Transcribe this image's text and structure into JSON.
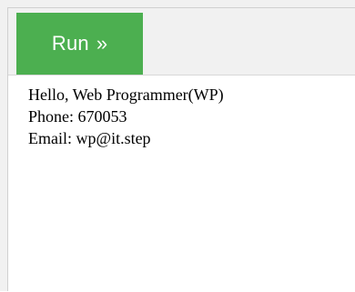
{
  "toolbar": {
    "run_label": "Run",
    "run_arrow": "»",
    "accent_color": "#4caf50"
  },
  "output": {
    "lines": [
      "Hello, Web Programmer(WP)",
      "Phone: 670053",
      "Email: wp@it.step"
    ]
  }
}
